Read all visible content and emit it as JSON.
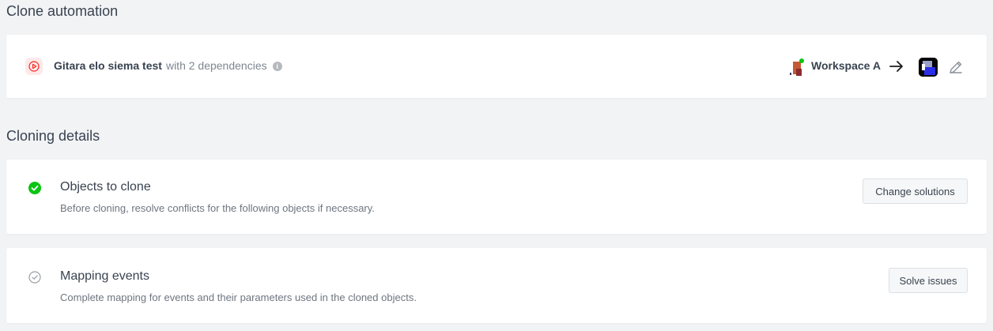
{
  "headings": {
    "clone_automation": "Clone automation",
    "cloning_details": "Cloning details"
  },
  "automation": {
    "name": "Gitara elo siema test",
    "dependencies": "with 2 dependencies",
    "info_icon": "i",
    "source_workspace": "Workspace A"
  },
  "details": [
    {
      "title": "Objects to clone",
      "description": "Before cloning, resolve conflicts for the following objects if necessary.",
      "button": "Change solutions",
      "status": "complete"
    },
    {
      "title": "Mapping events",
      "description": "Complete mapping for events and their parameters used in the cloned objects.",
      "button": "Solve issues",
      "status": "pending"
    }
  ],
  "icons": {
    "play": "play-icon",
    "info": "info-icon",
    "arrow": "arrow-right-icon",
    "edit": "pencil-icon",
    "complete": "check-circle-icon",
    "pending": "check-circle-outline-icon"
  },
  "colors": {
    "background": "#f2f3f5",
    "card": "#ffffff",
    "accent_red": "#f52922",
    "success_green": "#0bc413",
    "text_primary": "#384350",
    "text_secondary": "#6e7680"
  }
}
